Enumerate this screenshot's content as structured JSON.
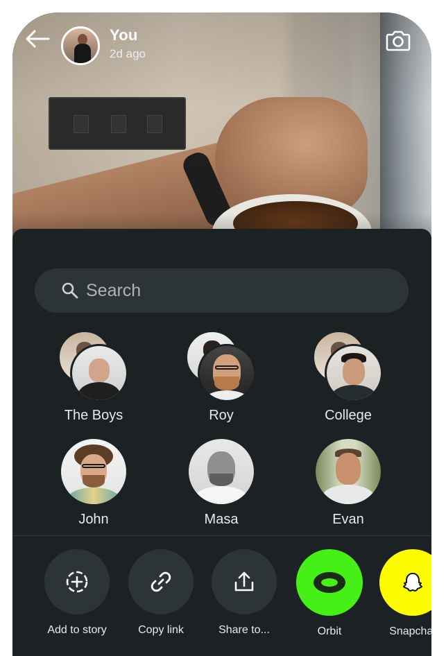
{
  "header": {
    "user_name": "You",
    "post_time": "2d ago"
  },
  "search": {
    "placeholder": "Search"
  },
  "contacts": [
    {
      "label": "The Boys",
      "type": "group"
    },
    {
      "label": "Roy",
      "type": "group"
    },
    {
      "label": "College",
      "type": "group"
    },
    {
      "label": "John",
      "type": "person"
    },
    {
      "label": "Masa",
      "type": "person"
    },
    {
      "label": "Evan",
      "type": "person"
    }
  ],
  "actions": [
    {
      "label": "Add to story",
      "icon": "add-to-story-icon"
    },
    {
      "label": "Copy link",
      "icon": "link-icon"
    },
    {
      "label": "Share to...",
      "icon": "share-icon"
    },
    {
      "label": "Orbit",
      "icon": "orbit-icon",
      "color": "#45f016"
    },
    {
      "label": "Snapchat",
      "icon": "snapchat-ghost-icon",
      "color": "#fffc00"
    }
  ],
  "colors": {
    "sheet_background": "#1c2123",
    "search_background": "#2d3438",
    "action_background": "#2d3438"
  }
}
